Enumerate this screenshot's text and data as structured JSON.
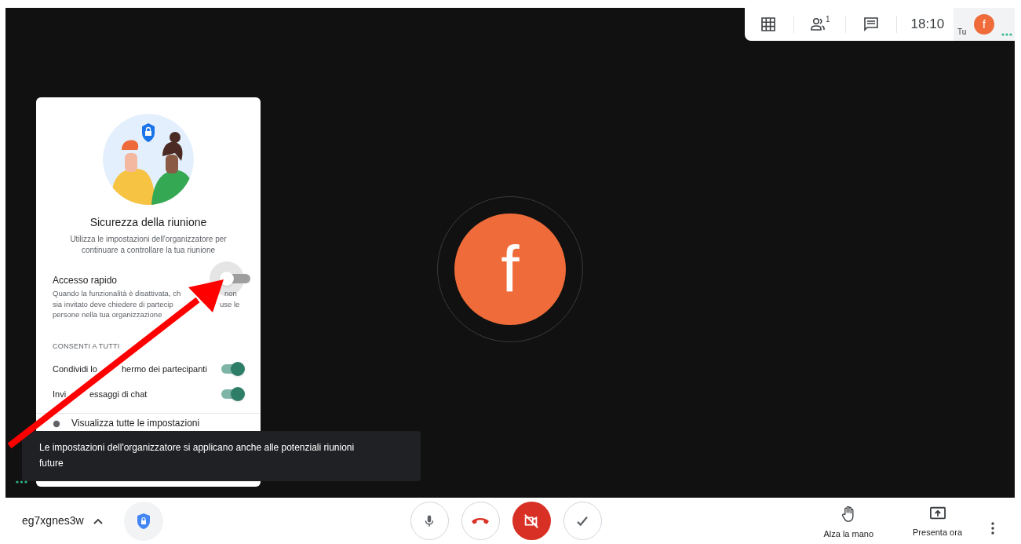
{
  "top_bar": {
    "participants_count": "1",
    "time": "18:10",
    "self_label": "Tu",
    "self_avatar": "f"
  },
  "security_panel": {
    "title": "Sicurezza della riunione",
    "subtitle": "Utilizza le impostazioni dell'organizzatore per continuare a controllare la tua riunione",
    "quick_access": {
      "label": "Accesso rapido",
      "on": false,
      "description_lines": [
        [
          "Quando la funzionalità è disattivata, ch",
          "non"
        ],
        [
          "sia invitato deve chiedere di partecip",
          "use le"
        ],
        [
          "persone nella tua organizzazione"
        ]
      ]
    },
    "section_heading": "CONSENTI A TUTTI",
    "toggles": [
      {
        "label_parts": [
          "Condividi lo",
          "hermo dei partecipanti"
        ],
        "on": true
      },
      {
        "label_parts": [
          "Invi",
          "essaggi di chat"
        ],
        "on": true
      }
    ],
    "footer_link": "Visualizza tutte le impostazioni"
  },
  "toast": "Le impostazioni dell'organizzatore si applicano anche alle potenziali riunioni future",
  "main_avatar": "f",
  "bottom_bar": {
    "meeting_code": "eg7xgnes3w",
    "controls": [
      {
        "kind": "mic"
      },
      {
        "kind": "hangup"
      },
      {
        "kind": "camera-off"
      },
      {
        "kind": "check"
      }
    ],
    "actions": [
      {
        "kind": "hand",
        "label": "Alza la mano"
      },
      {
        "kind": "present",
        "label": "Presenta ora"
      }
    ]
  }
}
